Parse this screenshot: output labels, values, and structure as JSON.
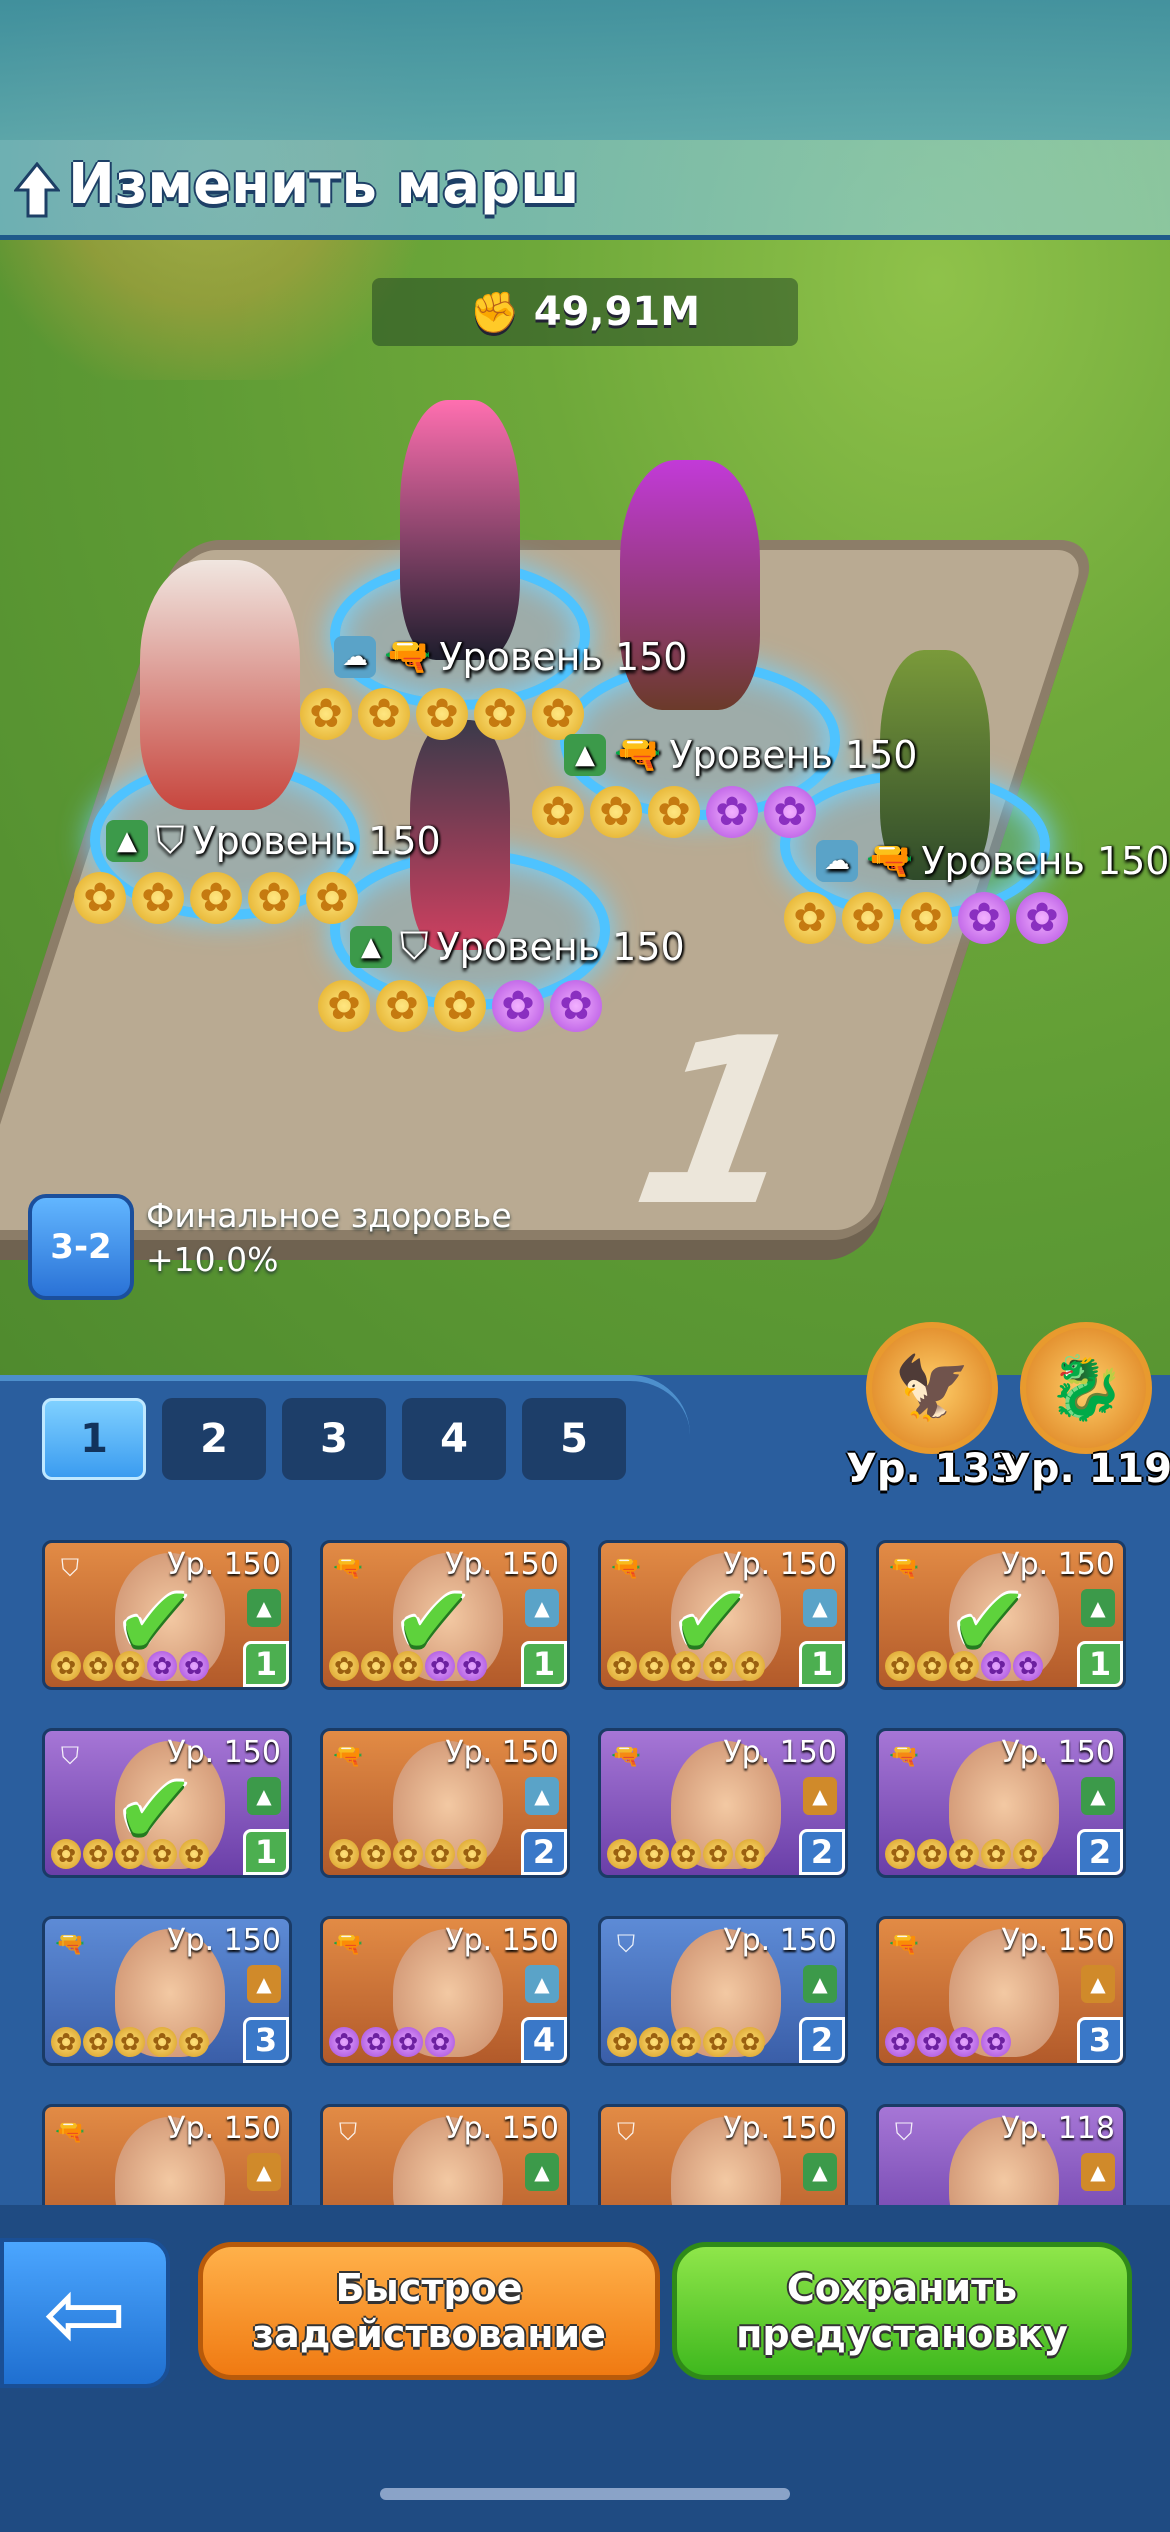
{
  "header": {
    "title": "Изменить марш"
  },
  "power": {
    "value": "49,91M"
  },
  "board_number": "1",
  "heroes": [
    {
      "level": "Уровень 150",
      "stars": [
        "g",
        "g",
        "g",
        "g",
        "g"
      ]
    },
    {
      "level": "Уровень 150",
      "stars": [
        "g",
        "g",
        "g",
        "p",
        "p"
      ]
    },
    {
      "level": "Уровень 150",
      "stars": [
        "g",
        "g",
        "g",
        "g",
        "g"
      ]
    },
    {
      "level": "Уровень 150",
      "stars": [
        "g",
        "g",
        "g",
        "p",
        "p"
      ]
    },
    {
      "level": "Уровень 150",
      "stars": [
        "g",
        "g",
        "g",
        "p",
        "p"
      ]
    }
  ],
  "bonus": {
    "badge": "3-2",
    "line1": "Финальное здоровье",
    "line2": "+10.0%"
  },
  "pets": [
    {
      "level": "Ур. 133"
    },
    {
      "level": "Ур. 119"
    }
  ],
  "tabs": [
    "1",
    "2",
    "3",
    "4",
    "5"
  ],
  "active_tab": "1",
  "cards": [
    {
      "level": "Ур. 150",
      "count": "1",
      "selected": true,
      "bg": "orange",
      "stars": "gggpp"
    },
    {
      "level": "Ур. 150",
      "count": "1",
      "selected": true,
      "bg": "orange",
      "stars": "gggpp"
    },
    {
      "level": "Ур. 150",
      "count": "1",
      "selected": true,
      "bg": "orange",
      "stars": "ggggg"
    },
    {
      "level": "Ур. 150",
      "count": "1",
      "selected": true,
      "bg": "orange",
      "stars": "gggpp"
    },
    {
      "level": "Ур. 150",
      "count": "1",
      "selected": true,
      "bg": "purple",
      "stars": "ggggg"
    },
    {
      "level": "Ур. 150",
      "count": "2",
      "selected": false,
      "bg": "orange",
      "stars": "ggggg"
    },
    {
      "level": "Ур. 150",
      "count": "2",
      "selected": false,
      "bg": "purple",
      "stars": "ggggg"
    },
    {
      "level": "Ур. 150",
      "count": "2",
      "selected": false,
      "bg": "purple",
      "stars": "ggggg"
    },
    {
      "level": "Ур. 150",
      "count": "3",
      "selected": false,
      "bg": "blue",
      "stars": "ggggg"
    },
    {
      "level": "Ур. 150",
      "count": "4",
      "selected": false,
      "bg": "orange",
      "stars": "pppp"
    },
    {
      "level": "Ур. 150",
      "count": "2",
      "selected": false,
      "bg": "blue",
      "stars": "ggggg"
    },
    {
      "level": "Ур. 150",
      "count": "3",
      "selected": false,
      "bg": "orange",
      "stars": "pppp"
    },
    {
      "level": "Ур. 150",
      "count": "",
      "selected": false,
      "bg": "orange",
      "stars": ""
    },
    {
      "level": "Ур. 150",
      "count": "",
      "selected": false,
      "bg": "orange",
      "stars": ""
    },
    {
      "level": "Ур. 150",
      "count": "",
      "selected": false,
      "bg": "orange",
      "stars": ""
    },
    {
      "level": "Ур. 118",
      "count": "",
      "selected": false,
      "bg": "purple",
      "stars": ""
    }
  ],
  "buttons": {
    "quick": "Быстрое задействование",
    "save": "Сохранить предустановку"
  }
}
